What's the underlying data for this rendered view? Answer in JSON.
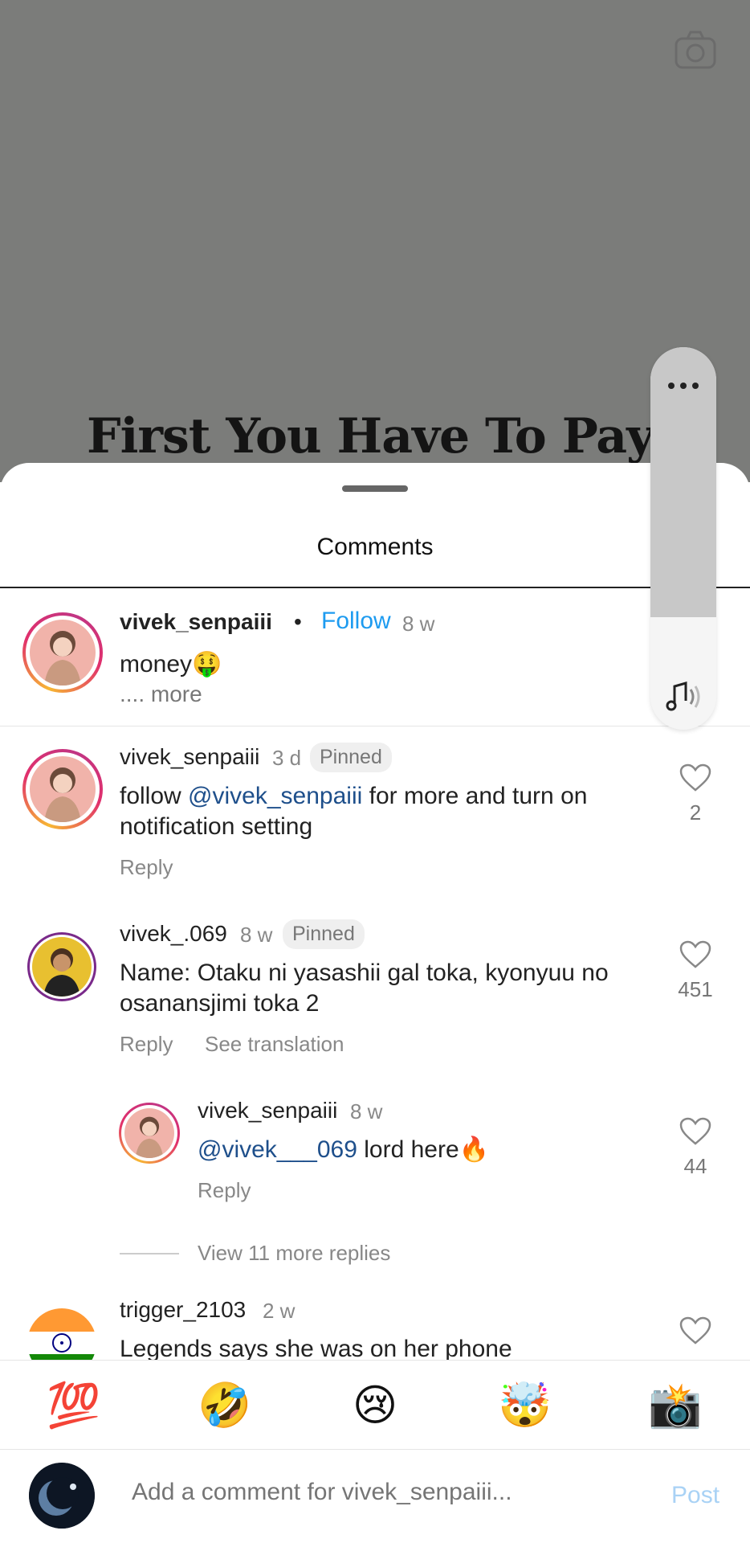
{
  "video": {
    "caption_text": "First You Have To Pay",
    "caption_symbol": "$"
  },
  "sheet": {
    "title": "Comments"
  },
  "caption_post": {
    "username": "vivek_senpaiii",
    "follow_label": "Follow",
    "time": "8 w",
    "text": "money🤑",
    "more_label": ".... more"
  },
  "comments": [
    {
      "username": "vivek_senpaiii",
      "time": "3 d",
      "badge": "Pinned",
      "text_prefix": "follow ",
      "mention": "@vivek_senpaiii",
      "text_suffix": " for more and turn on notification setting",
      "reply_label": "Reply",
      "likes": "2"
    },
    {
      "username": "vivek_.069",
      "time": "8 w",
      "badge": "Pinned",
      "text": "Name: Otaku ni yasashii gal toka, kyonyuu no osanansjimi toka 2",
      "reply_label": "Reply",
      "translate_label": "See translation",
      "likes": "451"
    },
    {
      "username": "vivek_senpaiii",
      "time": "8 w",
      "mention": "@vivek___069",
      "text_suffix": " lord here🔥",
      "reply_label": "Reply",
      "likes": "44"
    },
    {
      "username": "trigger_2103",
      "time": "2 w",
      "text": "Legends says she was on her phone"
    }
  ],
  "view_more_replies": "View 11 more replies",
  "emoji_bar": [
    "💯",
    "🤣",
    "😢",
    "🤯",
    "📸"
  ],
  "composer": {
    "placeholder": "Add a comment for vivek_senpaiii...",
    "post_label": "Post"
  },
  "colors": {
    "accent": "#1d9bf0",
    "mention": "#1e4f8b",
    "post_disabled": "#a9d2f5"
  }
}
